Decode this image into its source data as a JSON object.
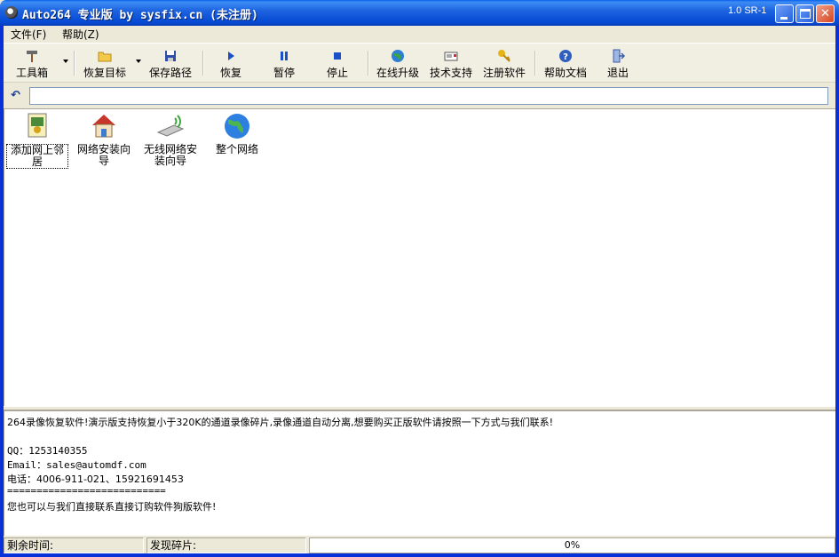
{
  "window": {
    "title": "Auto264 专业版 by sysfix.cn (未注册)",
    "version": "1.0 SR-1"
  },
  "menu": [
    {
      "label": "文件(F)"
    },
    {
      "label": "帮助(Z)"
    }
  ],
  "toolbar": {
    "tools": "工具箱",
    "restore_target": "恢复目标",
    "save_path": "保存路径",
    "restore": "恢复",
    "pause": "暂停",
    "stop": "停止",
    "online_upgrade": "在线升级",
    "tech_support": "技术支持",
    "register": "注册软件",
    "help_doc": "帮助文档",
    "exit": "退出"
  },
  "address": {
    "value": ""
  },
  "nodes": [
    {
      "label": "添加网上邻居"
    },
    {
      "label": "网络安装向导"
    },
    {
      "label": "无线网络安装向导"
    },
    {
      "label": "整个网络"
    }
  ],
  "log": [
    "264录像恢复软件!演示版支持恢复小于320K的通道录像碎片,录像通道自动分离,想要购买正版软件请按照一下方式与我们联系!",
    "",
    "QQ：1253140355",
    "Email：sales@automdf.com",
    "电话：4006-911-021、15921691453",
    "===========================",
    "您也可以与我们直接联系直接订购软件狗版软件!"
  ],
  "status": {
    "remaining_time": "剩余时间:",
    "found_fragments": "发现碎片:",
    "progress_text": "0%",
    "progress": 0
  },
  "colors": {
    "titlebar": "#0548D3",
    "frame": "#0831D9",
    "face": "#ECE9D8",
    "close": "#D7461F"
  }
}
